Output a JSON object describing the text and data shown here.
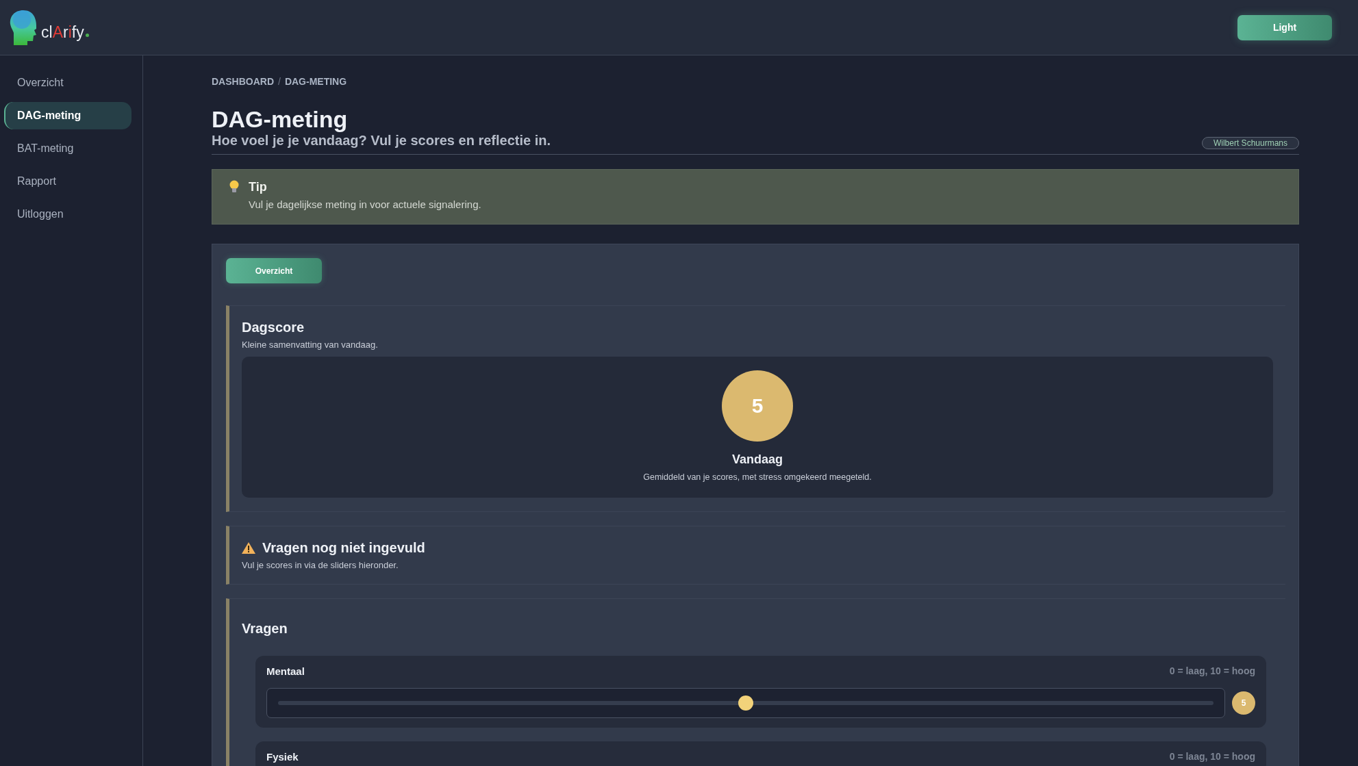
{
  "header": {
    "logo": [
      {
        "text": "cl",
        "accent": false
      },
      {
        "text": "A",
        "accent": true
      },
      {
        "text": "r",
        "accent": false
      },
      {
        "text": "i",
        "accent": true
      },
      {
        "text": "fy",
        "accent": false
      }
    ],
    "theme_button": "Light"
  },
  "sidebar": {
    "items": [
      {
        "label": "Overzicht",
        "selected": false
      },
      {
        "label": "DAG-meting",
        "selected": true
      },
      {
        "label": "BAT-meting",
        "selected": false
      },
      {
        "label": "Rapport",
        "selected": false
      },
      {
        "label": "Uitloggen",
        "selected": false
      }
    ]
  },
  "breadcrumb": {
    "separator": "/",
    "items": [
      "DASHBOARD",
      "DAG-METING"
    ]
  },
  "page": {
    "title": "DAG-meting",
    "subtitle": "Hoe voel je je vandaag? Vul je scores en reflectie in.",
    "user": "Wilbert Schuurmans"
  },
  "tip": {
    "title": "Tip",
    "text": "Vul je dagelijkse meting in voor actuele signalering."
  },
  "overview_button": "Overzicht",
  "dagscore": {
    "title": "Dagscore",
    "subtitle": "Kleine samenvatting van vandaag.",
    "score": "5",
    "label": "Vandaag",
    "note": "Gemiddeld van je scores, met stress omgekeerd meegeteld."
  },
  "warning": {
    "title": "Vragen nog niet ingevuld",
    "text": "Vul je scores in via de sliders hieronder."
  },
  "questions": {
    "title": "Vragen",
    "items": [
      {
        "name": "Mentaal",
        "hint": "0 = laag, 10 = hoog",
        "level": 0.5,
        "value": "5"
      },
      {
        "name": "Fysiek",
        "hint": "0 = laag, 10 = hoog"
      }
    ]
  }
}
